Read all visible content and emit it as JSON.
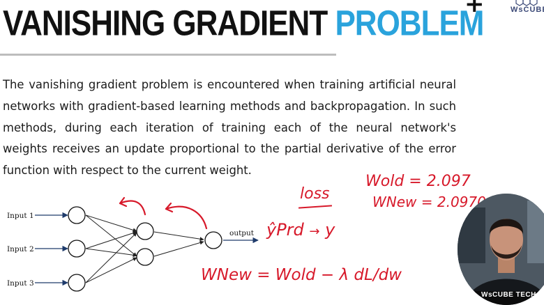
{
  "header": {
    "title_part1": "VANISHING GRADIENT",
    "title_part2": "PROBLEM",
    "title_accent": "#2aa3dc",
    "plus_glyph": "+",
    "logo_text": "WsCUBE"
  },
  "body": {
    "paragraph": "The vanishing gradient problem is encountered when training artificial neural networks with gradient-based learning methods and backpropagation. In such methods, during each iteration of training each of the neural network's weights receives an update proportional to the partial derivative of the error function with respect to the current weight."
  },
  "diagram": {
    "inputs": [
      "Input 1",
      "Input 2",
      "Input 3"
    ],
    "output_label": "output"
  },
  "annotations": {
    "ink_color": "#d7192a",
    "loss": "loss",
    "y_pred": "ŷPrd",
    "y_true": "y",
    "w_new_formula": "WNew = Wold − λ dL/dw",
    "w_old_value": "Wold = 2.097",
    "w_new_value": "WNew = 2.0970"
  },
  "webcam": {
    "banner_text": "WsCUBE TECH"
  }
}
